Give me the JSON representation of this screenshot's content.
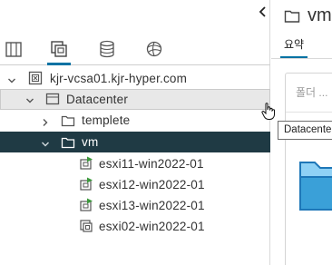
{
  "navigator": {
    "tabs": [
      {
        "name": "hosts-and-clusters",
        "active": false
      },
      {
        "name": "vms-and-templates",
        "active": true
      },
      {
        "name": "storage",
        "active": false
      },
      {
        "name": "networking",
        "active": false
      }
    ],
    "tree": {
      "vcenter": "kjr-vcsa01.kjr-hyper.com",
      "datacenter": "Datacenter",
      "folders": [
        {
          "label": "templete",
          "expanded": false
        },
        {
          "label": "vm",
          "expanded": true,
          "selected": true
        }
      ],
      "vms": [
        {
          "label": "esxi11-win2022-01",
          "state": "powered-on"
        },
        {
          "label": "esxi12-win2022-01",
          "state": "powered-on"
        },
        {
          "label": "esxi13-win2022-01",
          "state": "powered-on"
        },
        {
          "label": "esxi02-win2022-01",
          "state": "powered-off"
        }
      ]
    }
  },
  "detail": {
    "title": "vm",
    "tab": "요약",
    "card_title": "폴더 ..."
  },
  "tooltip": "Datacente",
  "colors": {
    "accent": "#0072a3",
    "selected_row": "#1f3a44",
    "hover_row": "#e8e8e8",
    "folder_icon": "#3aa0d8",
    "vm_running": "#3c9a3c"
  }
}
